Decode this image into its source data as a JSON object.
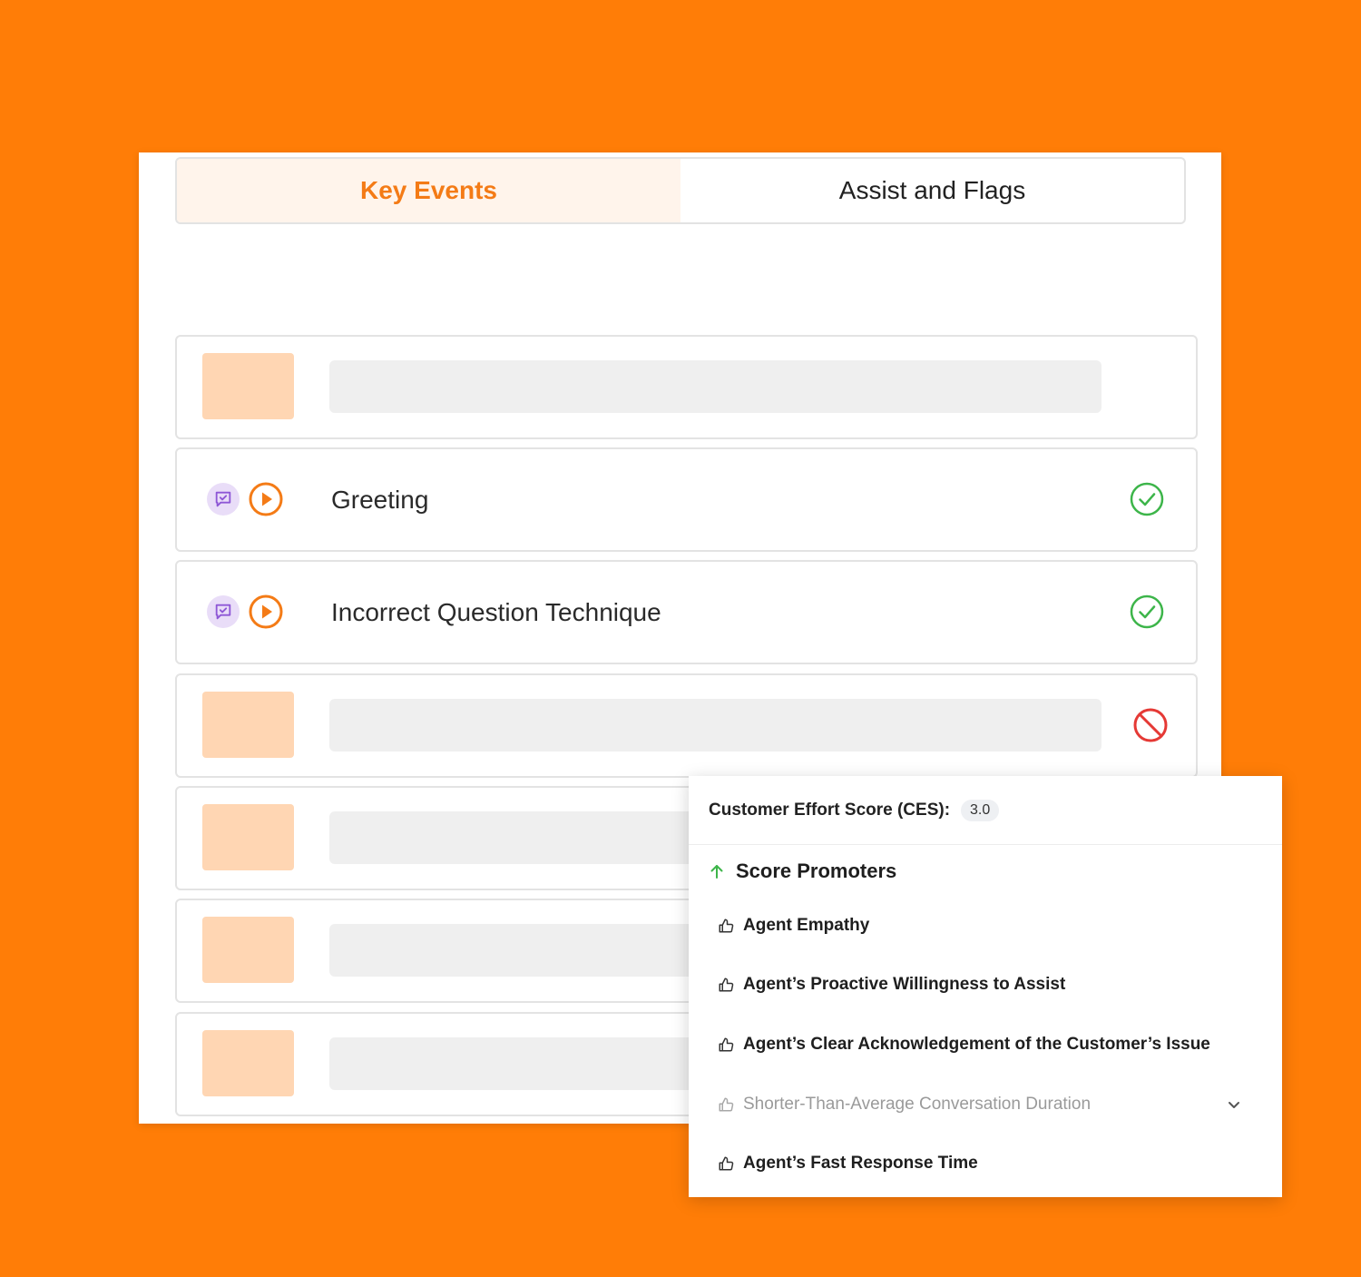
{
  "tabs": [
    {
      "label": "Key Events",
      "active": true
    },
    {
      "label": "Assist and Flags",
      "active": false
    }
  ],
  "events": [
    {
      "label": "Greeting",
      "status": "check-circle-icon"
    },
    {
      "label": "Incorrect Question Technique",
      "status": "check-circle-icon"
    }
  ],
  "colors": {
    "accent": "#F47B16",
    "success": "#3DB54A",
    "danger": "#E53935",
    "chat": "#8E57D6",
    "background": "#FF7D07"
  },
  "ces": {
    "title": "Customer Effort Score (CES):",
    "score": "3.0",
    "promoters_title": "Score Promoters",
    "promoters": [
      {
        "label": "Agent Empathy"
      },
      {
        "label": "Agent’s Proactive Willingness to Assist"
      },
      {
        "label": "Agent’s Clear Acknowledgement of the Customer’s Issue"
      },
      {
        "label": "Shorter-Than-Average Conversation Duration"
      },
      {
        "label": "Agent’s Fast Response Time"
      }
    ]
  }
}
